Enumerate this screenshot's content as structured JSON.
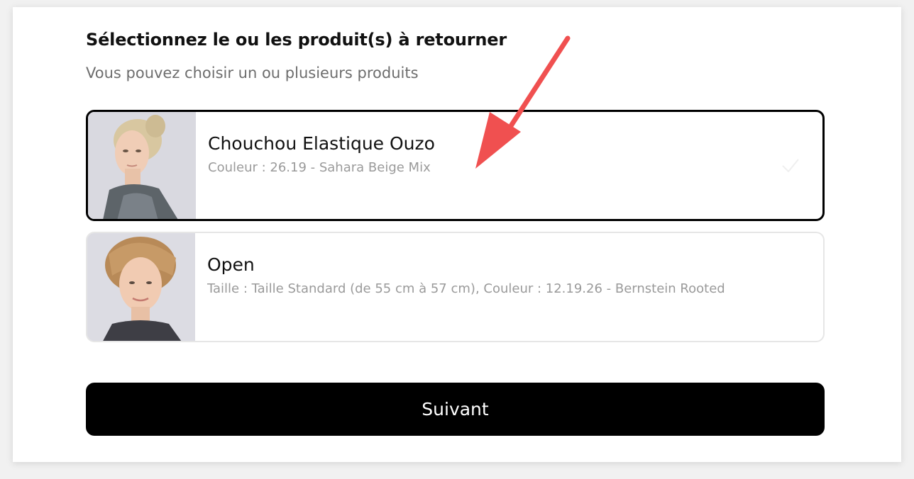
{
  "title": "Sélectionnez le ou les produit(s) à retourner",
  "subtitle": "Vous pouvez choisir un ou plusieurs produits",
  "products": [
    {
      "name": "Chouchou Elastique Ouzo",
      "detail": "Couleur : 26.19 - Sahara Beige Mix",
      "selected": true
    },
    {
      "name": "Open",
      "detail": "Taille : Taille Standard (de 55 cm à 57 cm), Couleur : 12.19.26 - Bernstein Rooted",
      "selected": false
    }
  ],
  "next_button": "Suivant",
  "colors": {
    "annotation_arrow": "#f05050",
    "button_bg": "#000000",
    "selected_border": "#000000"
  },
  "icons": {
    "check": "check-icon"
  }
}
